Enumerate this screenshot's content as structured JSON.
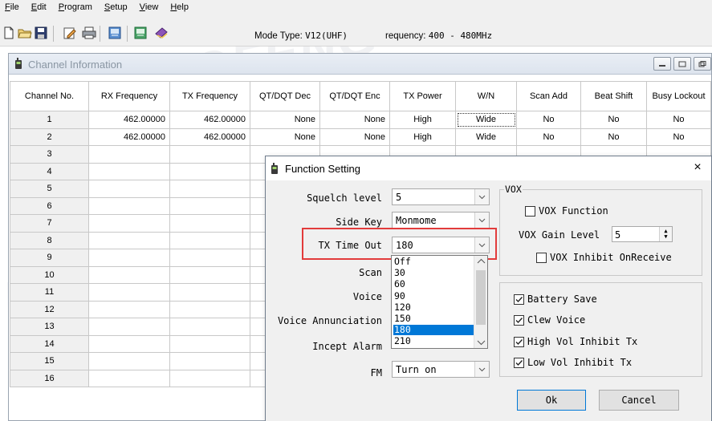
{
  "menu": [
    "File",
    "Edit",
    "Program",
    "Setup",
    "View",
    "Help"
  ],
  "menu_underline": [
    "F",
    "E",
    "P",
    "S",
    "V",
    "H"
  ],
  "toolbar": {
    "mode_prefix": "Mode Type: ",
    "mode_value": "V12(UHF)",
    "freq_prefix": "requency: ",
    "freq_value": " 400 - 480MHz"
  },
  "channel_window": {
    "title": "Channel Information",
    "columns": [
      "Channel No.",
      "RX Frequency",
      "TX Frequency",
      "QT/DQT Dec",
      "QT/DQT Enc",
      "TX Power",
      "W/N",
      "Scan Add",
      "Beat Shift",
      "Busy Lockout"
    ],
    "rows": [
      [
        "1",
        "462.00000",
        "462.00000",
        "None",
        "None",
        "High",
        "Wide",
        "No",
        "No",
        "No"
      ],
      [
        "2",
        "462.00000",
        "462.00000",
        "None",
        "None",
        "High",
        "Wide",
        "No",
        "No",
        "No"
      ],
      [
        "3",
        "",
        "",
        "",
        "",
        "",
        "",
        "",
        "",
        ""
      ],
      [
        "4",
        "",
        "",
        "",
        "",
        "",
        "",
        "",
        "",
        ""
      ],
      [
        "5",
        "",
        "",
        "",
        "",
        "",
        "",
        "",
        "",
        ""
      ],
      [
        "6",
        "",
        "",
        "",
        "",
        "",
        "",
        "",
        "",
        ""
      ],
      [
        "7",
        "",
        "",
        "",
        "",
        "",
        "",
        "",
        "",
        ""
      ],
      [
        "8",
        "",
        "",
        "",
        "",
        "",
        "",
        "",
        "",
        ""
      ],
      [
        "9",
        "",
        "",
        "",
        "",
        "",
        "",
        "",
        "",
        ""
      ],
      [
        "10",
        "",
        "",
        "",
        "",
        "",
        "",
        "",
        "",
        ""
      ],
      [
        "11",
        "",
        "",
        "",
        "",
        "",
        "",
        "",
        "",
        ""
      ],
      [
        "12",
        "",
        "",
        "",
        "",
        "",
        "",
        "",
        "",
        ""
      ],
      [
        "13",
        "",
        "",
        "",
        "",
        "",
        "",
        "",
        "",
        ""
      ],
      [
        "14",
        "",
        "",
        "",
        "",
        "",
        "",
        "",
        "",
        ""
      ],
      [
        "15",
        "",
        "",
        "",
        "",
        "",
        "",
        "",
        "",
        ""
      ],
      [
        "16",
        "",
        "",
        "",
        "",
        "",
        "",
        "",
        "",
        ""
      ]
    ]
  },
  "dialog": {
    "title": "Function Setting",
    "close": "×",
    "squelch_label": "Squelch level",
    "squelch_value": "5",
    "sidekey_label": "Side Key",
    "sidekey_value": "Monmome",
    "txtimeout_label": "TX Time Out",
    "txtimeout_value": "180",
    "scan_label": "Scan",
    "voice_label": "Voice",
    "voice_annunciation_label": "Voice Annunciation",
    "incept_alarm_label": "Incept Alarm",
    "fm_label": "FM",
    "fm_value": "Turn on",
    "dropdown_options": [
      "Off",
      "30",
      "60",
      "90",
      "120",
      "150",
      "180",
      "210"
    ],
    "dropdown_selected": "180",
    "vox_group_label": "VOX",
    "vox_function_label": "VOX Function",
    "vox_function_checked": false,
    "vox_gain_label": "VOX Gain Level",
    "vox_gain_value": "5",
    "vox_inhibit_label": "VOX Inhibit OnReceive",
    "vox_inhibit_checked": false,
    "battery_save_label": "Battery Save",
    "battery_save_checked": true,
    "clew_voice_label": "Clew Voice",
    "clew_voice_checked": true,
    "high_vol_label": "High Vol Inhibit Tx",
    "high_vol_checked": true,
    "low_vol_label": "Low Vol Inhibit Tx",
    "low_vol_checked": true,
    "ok_label": "Ok",
    "cancel_label": "Cancel"
  },
  "colors": {
    "highlight_box": "#e23b3b",
    "selection": "#0078d7"
  }
}
